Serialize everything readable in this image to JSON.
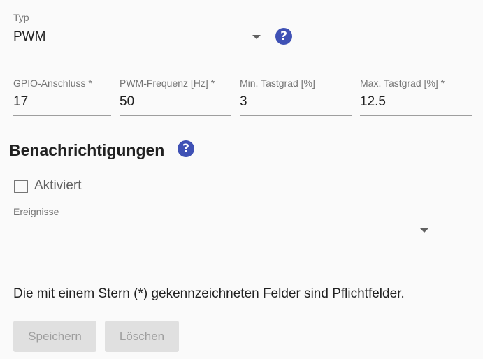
{
  "type_field": {
    "label": "Typ",
    "value": "PWM",
    "help_icon": "help-circle-icon",
    "dropdown_icon": "caret-down-icon"
  },
  "params": {
    "gpio": {
      "label": "GPIO-Anschluss *",
      "value": "17"
    },
    "frequency": {
      "label": "PWM-Frequenz [Hz] *",
      "value": "50"
    },
    "min_duty": {
      "label": "Min. Tastgrad [%]",
      "value": "3"
    },
    "max_duty": {
      "label": "Max. Tastgrad [%] *",
      "value": "12.5"
    }
  },
  "notifications": {
    "heading": "Benachrichtigungen",
    "help_icon": "help-circle-icon",
    "enabled_label": "Aktiviert",
    "enabled": false,
    "events_label": "Ereignisse",
    "events_value": ""
  },
  "footer": {
    "required_note": "Die mit einem Stern (*) gekennzeichneten Felder sind Pflichtfelder.",
    "save_label": "Speichern",
    "delete_label": "Löschen"
  },
  "colors": {
    "accent": "#3f51b5",
    "background": "#fafafa",
    "button_disabled_bg": "#e0e0e0",
    "button_disabled_text": "#9e9e9e"
  }
}
